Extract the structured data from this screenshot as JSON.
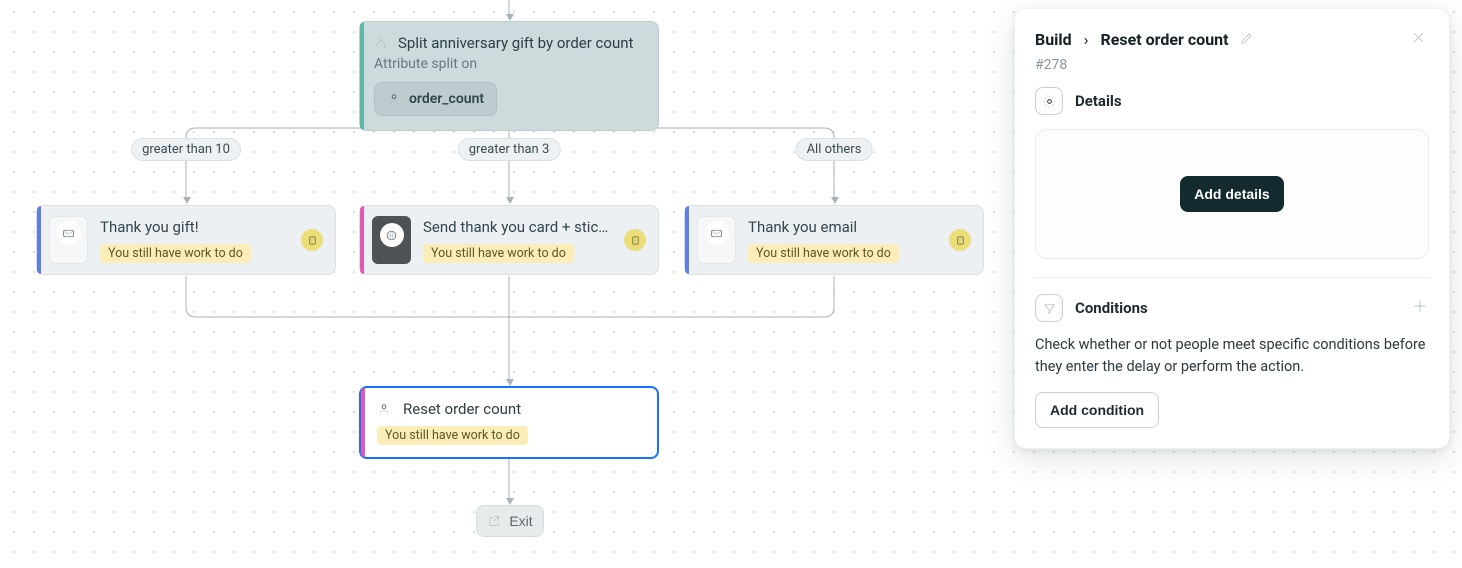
{
  "split": {
    "title": "Split anniversary gift by order count",
    "subtitle": "Attribute split on",
    "attribute": "order_count",
    "branches": [
      {
        "label": "greater than 10"
      },
      {
        "label": "greater than 3"
      },
      {
        "label": "All others"
      }
    ]
  },
  "cards": {
    "gift": {
      "title": "Thank you gift!",
      "status": "You still have work to do"
    },
    "sticker": {
      "title": "Send thank you card + stic…",
      "status": "You still have work to do"
    },
    "email": {
      "title": "Thank you email",
      "status": "You still have work to do"
    }
  },
  "selected": {
    "title": "Reset order count",
    "status": "You still have work to do"
  },
  "exit": {
    "label": "Exit"
  },
  "panel": {
    "breadcrumb": "Build",
    "title": "Reset order count",
    "hash": "#278",
    "details": {
      "title": "Details",
      "cta": "Add details"
    },
    "conditions": {
      "title": "Conditions",
      "desc": "Check whether or not people meet specific conditions before they enter the delay or perform the action.",
      "cta": "Add condition"
    }
  }
}
